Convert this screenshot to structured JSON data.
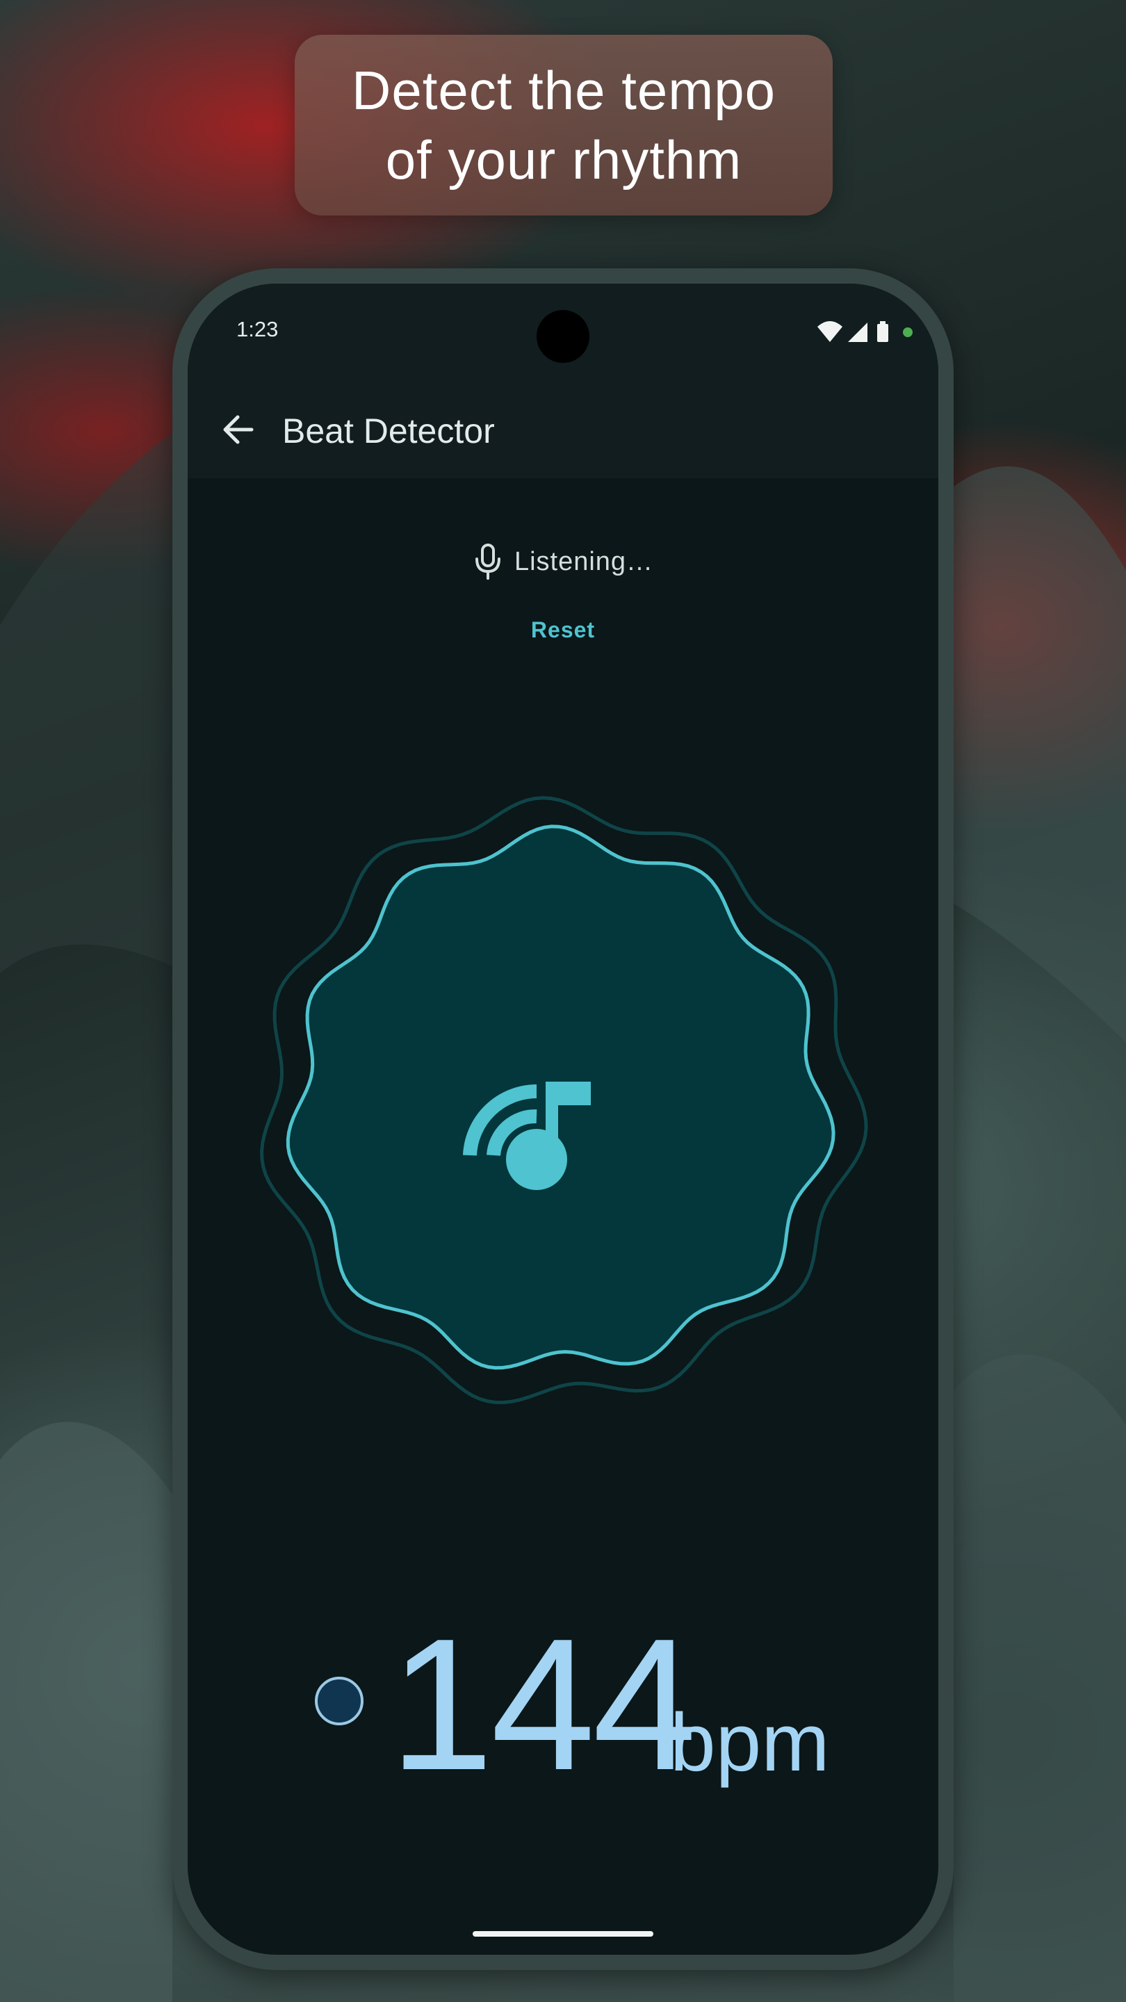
{
  "headline": {
    "line1": "Detect the tempo",
    "line2": "of your rhythm"
  },
  "status_bar": {
    "time": "1:23",
    "icons": [
      "wifi-icon",
      "signal-icon",
      "battery-icon",
      "privacy-indicator-dot"
    ]
  },
  "app_bar": {
    "back_icon": "arrow-back-icon",
    "title": "Beat Detector"
  },
  "status": {
    "icon": "mic-icon",
    "text": "Listening…"
  },
  "reset_label": "Reset",
  "visualizer": {
    "icon": "music-note-waves-icon"
  },
  "bpm": {
    "value": "144",
    "unit": "bpm"
  },
  "colors": {
    "screen_bg": "#0b1718",
    "app_bar_bg": "#111d1e",
    "accent": "#4fc3cf",
    "blob_fill": "#03373b",
    "outer_ring": "#0f4448",
    "bpm_text": "#a4d4f4",
    "phone_frame": "#364645",
    "headline_bg": "#7d5a50"
  }
}
